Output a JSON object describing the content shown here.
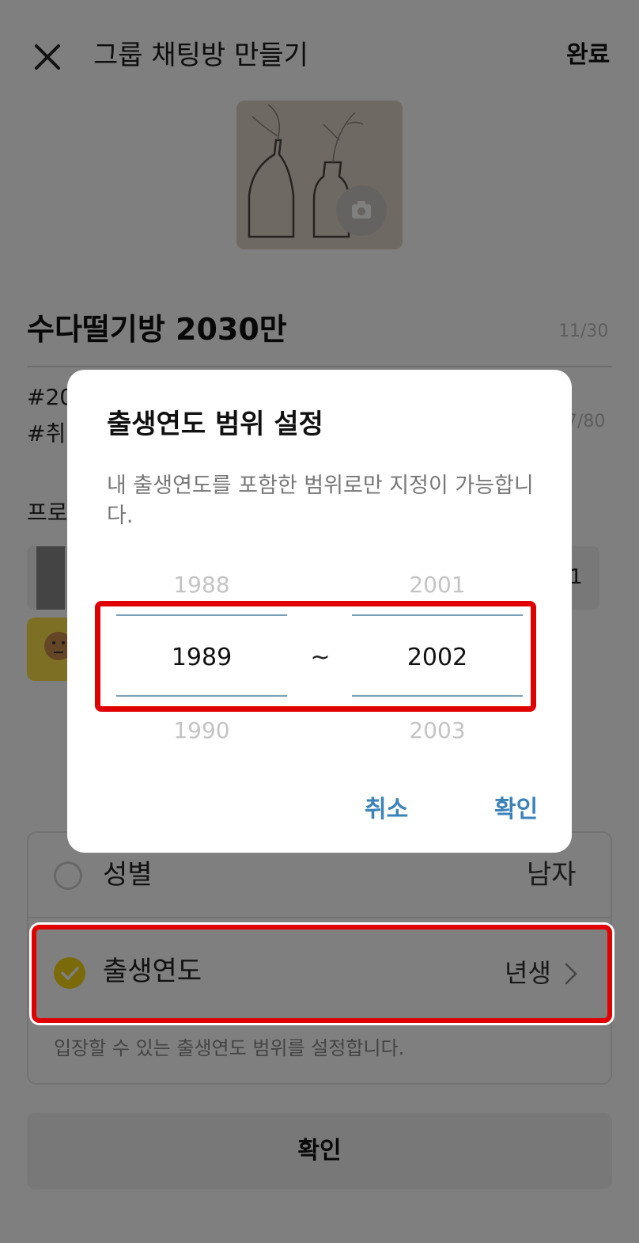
{
  "header": {
    "title": "그룹 채팅방 만들기",
    "done_label": "완료"
  },
  "room": {
    "name": "수다떨기방 2030만",
    "name_count": "11/30"
  },
  "hashtags": {
    "line1": "#20",
    "line2": "#취",
    "count": "7/80"
  },
  "profile": {
    "label": "프로",
    "count_fragment": "1"
  },
  "options": {
    "gender_label": "성별",
    "gender_value": "남자",
    "birth_label": "출생연도",
    "birth_value": "년생",
    "helper": "입장할 수 있는 출생연도 범위를 설정합니다."
  },
  "confirm_label": "확인",
  "dialog": {
    "title": "출생연도 범위 설정",
    "description": "내 출생연도를 포함한 범위로만 지정이 가능합니다.",
    "start": {
      "prev": "1988",
      "selected": "1989",
      "next": "1990"
    },
    "separator": "~",
    "end": {
      "prev": "2001",
      "selected": "2002",
      "next": "2003"
    },
    "cancel_label": "취소",
    "ok_label": "확인"
  },
  "colors": {
    "accent_blue": "#3a82b8",
    "highlight_red": "#e10000",
    "check_yellow": "#f5d414"
  }
}
